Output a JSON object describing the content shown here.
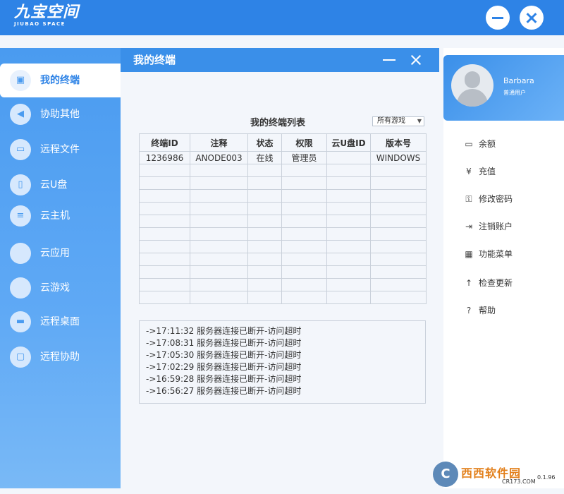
{
  "app": {
    "logo_cn": "九宝空间",
    "logo_en": "JIUBAO SPACE"
  },
  "nav": {
    "items": [
      {
        "label": "我的终端",
        "icon": "terminal-icon",
        "glyph": "▣",
        "active": true
      },
      {
        "label": "协助其他",
        "icon": "share-icon",
        "glyph": "◀",
        "active": false
      },
      {
        "label": "远程文件",
        "icon": "folder-icon",
        "glyph": "▭",
        "active": false
      },
      {
        "label": "云U盘",
        "icon": "usb-icon",
        "glyph": "▯",
        "active": false
      },
      {
        "label": "云主机",
        "icon": "server-icon",
        "glyph": "≡",
        "active": false
      },
      {
        "label": "云应用",
        "icon": "app-icon",
        "glyph": "",
        "active": false
      },
      {
        "label": "云游戏",
        "icon": "game-icon",
        "glyph": "",
        "active": false
      },
      {
        "label": "远程桌面",
        "icon": "monitor-icon",
        "glyph": "▬",
        "active": false
      },
      {
        "label": "远程协助",
        "icon": "remote-assist-icon",
        "glyph": "▢",
        "active": false
      }
    ]
  },
  "panel": {
    "title": "我的终端",
    "list_title": "我的终端列表",
    "filter_select": "所有游戏"
  },
  "table": {
    "headers": [
      "终端ID",
      "注释",
      "状态",
      "权限",
      "云U盘ID",
      "版本号"
    ],
    "rows": [
      [
        "1236986",
        "ANODE003",
        "在线",
        "管理员",
        "",
        "WINDOWS"
      ],
      [
        "",
        "",
        "",
        "",
        "",
        ""
      ],
      [
        "",
        "",
        "",
        "",
        "",
        ""
      ],
      [
        "",
        "",
        "",
        "",
        "",
        ""
      ],
      [
        "",
        "",
        "",
        "",
        "",
        ""
      ],
      [
        "",
        "",
        "",
        "",
        "",
        ""
      ],
      [
        "",
        "",
        "",
        "",
        "",
        ""
      ],
      [
        "",
        "",
        "",
        "",
        "",
        ""
      ],
      [
        "",
        "",
        "",
        "",
        "",
        ""
      ],
      [
        "",
        "",
        "",
        "",
        "",
        ""
      ],
      [
        "",
        "",
        "",
        "",
        "",
        ""
      ],
      [
        "",
        "",
        "",
        "",
        "",
        ""
      ]
    ]
  },
  "log": [
    "->17:11:32 服务器连接已断开-访问超时",
    "->17:08:31 服务器连接已断开-访问超时",
    "->17:05:30 服务器连接已断开-访问超时",
    "->17:02:29 服务器连接已断开-访问超时",
    "->16:59:28 服务器连接已断开-访问超时",
    "->16:56:27 服务器连接已断开-访问超时"
  ],
  "user": {
    "name": "Barbara",
    "role": "普通用户"
  },
  "menu": {
    "items": [
      {
        "label": "余额",
        "icon": "wallet-icon",
        "glyph": "▭"
      },
      {
        "label": "充值",
        "icon": "yen-icon",
        "glyph": "¥"
      },
      {
        "label": "修改密码",
        "icon": "lock-icon",
        "glyph": "⚿"
      },
      {
        "label": "注销账户",
        "icon": "logout-icon",
        "glyph": "⇥"
      },
      {
        "label": "功能菜单",
        "icon": "grid-icon",
        "glyph": "▦"
      },
      {
        "label": "检查更新",
        "icon": "update-icon",
        "glyph": "↑"
      },
      {
        "label": "帮助",
        "icon": "help-icon",
        "glyph": "?"
      }
    ]
  },
  "watermark": {
    "text": "西西软件园",
    "url": "CR173.COM",
    "logo": "C"
  },
  "version": "0.1.96"
}
